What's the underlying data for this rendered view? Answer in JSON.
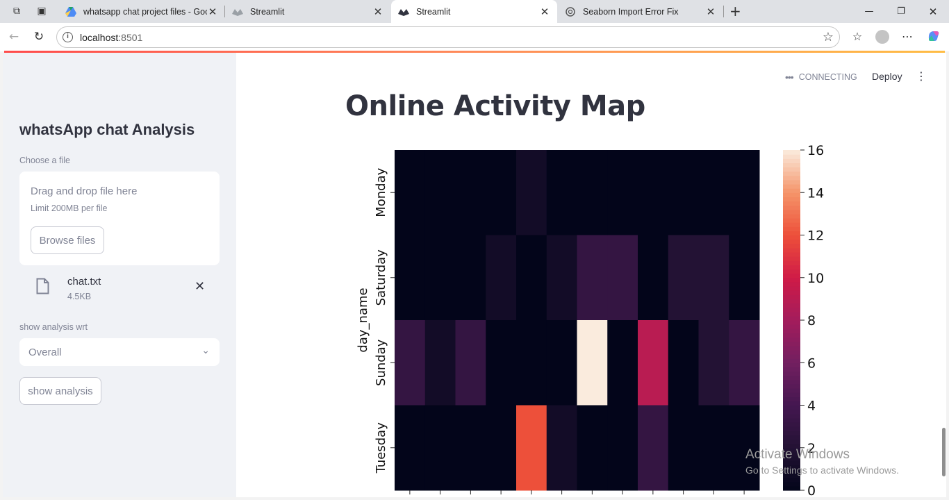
{
  "browser": {
    "tabs": [
      {
        "title": "whatsapp chat project files - Goo",
        "icon": "google-drive-icon",
        "active": false
      },
      {
        "title": "Streamlit",
        "icon": "streamlit-icon",
        "active": false
      },
      {
        "title": "Streamlit",
        "icon": "streamlit-icon",
        "active": true
      },
      {
        "title": "Seaborn Import Error Fix",
        "icon": "chatgpt-icon",
        "active": false
      }
    ],
    "url_host": "localhost",
    "url_port": ":8501"
  },
  "sidebar": {
    "title": "whatsApp chat Analysis",
    "uploader_label": "Choose a file",
    "dropzone_title": "Drag and drop file here",
    "dropzone_limit": "Limit 200MB per file",
    "browse_label": "Browse files",
    "file_name": "chat.txt",
    "file_size": "4.5KB",
    "select_label": "show analysis wrt",
    "select_value": "Overall",
    "submit_label": "show analysis"
  },
  "header": {
    "status": "CONNECTING",
    "deploy": "Deploy"
  },
  "main": {
    "title": "Online Activity Map"
  },
  "chart_data": {
    "type": "heatmap",
    "ylabel": "day_name",
    "xlabel": "",
    "rows": [
      "Monday",
      "Saturday",
      "Sunday",
      "Tuesday"
    ],
    "n_columns": 12,
    "values": [
      [
        0,
        0,
        0,
        0,
        1,
        0,
        0,
        0,
        0,
        0,
        0,
        0
      ],
      [
        0,
        0,
        0,
        1,
        0,
        1,
        3,
        3,
        0,
        2,
        2,
        0
      ],
      [
        3,
        1,
        3,
        0,
        0,
        0,
        16,
        0,
        9,
        0,
        2,
        3
      ],
      [
        0,
        0,
        0,
        0,
        12,
        1,
        0,
        0,
        3,
        0,
        0,
        0
      ]
    ],
    "colorbar_ticks": [
      0,
      2,
      4,
      6,
      8,
      10,
      12,
      14,
      16
    ],
    "vmin": 0,
    "vmax": 16,
    "colormap": "rocket"
  },
  "watermark": {
    "line1": "Activate Windows",
    "line2": "Go to Settings to activate Windows."
  }
}
